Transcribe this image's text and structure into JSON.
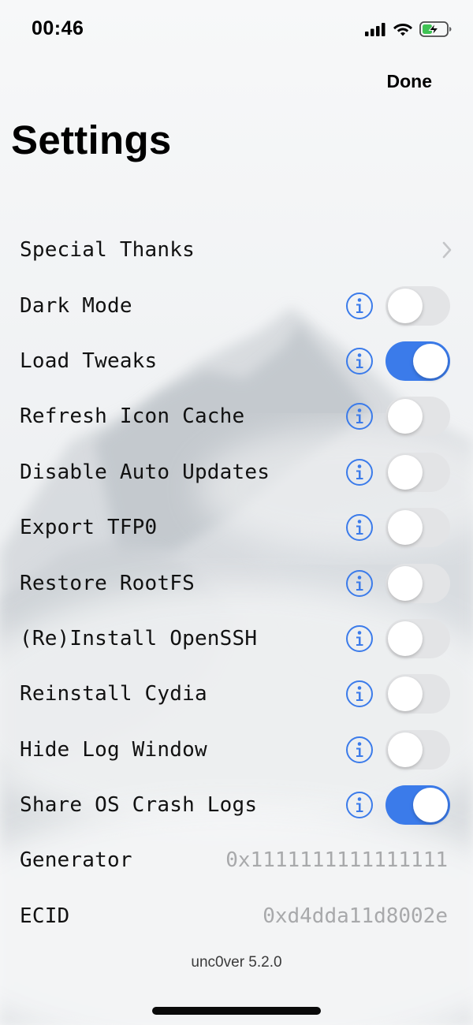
{
  "status_bar": {
    "time": "00:46",
    "icons": [
      "cellular-signal-icon",
      "wifi-icon",
      "battery-charging-icon"
    ]
  },
  "header": {
    "done_label": "Done",
    "title": "Settings"
  },
  "colors": {
    "accent": "#3b7bea",
    "toggle_off": "#e3e4e6",
    "value_text": "#a8a9ab"
  },
  "settings": {
    "special_thanks": {
      "label": "Special Thanks"
    },
    "toggles": [
      {
        "label": "Dark Mode",
        "on": false
      },
      {
        "label": "Load Tweaks",
        "on": true
      },
      {
        "label": "Refresh Icon Cache",
        "on": false
      },
      {
        "label": "Disable Auto Updates",
        "on": false
      },
      {
        "label": "Export TFP0",
        "on": false
      },
      {
        "label": "Restore RootFS",
        "on": false
      },
      {
        "label": "(Re)Install OpenSSH",
        "on": false
      },
      {
        "label": "Reinstall Cydia",
        "on": false
      },
      {
        "label": "Hide Log Window",
        "on": false
      },
      {
        "label": "Share OS Crash Logs",
        "on": true
      }
    ],
    "generator": {
      "label": "Generator",
      "value": "0x1111111111111111"
    },
    "ecid": {
      "label": "ECID",
      "value": "0xd4dda11d8002e"
    }
  },
  "footer": {
    "version": "unc0ver 5.2.0"
  }
}
